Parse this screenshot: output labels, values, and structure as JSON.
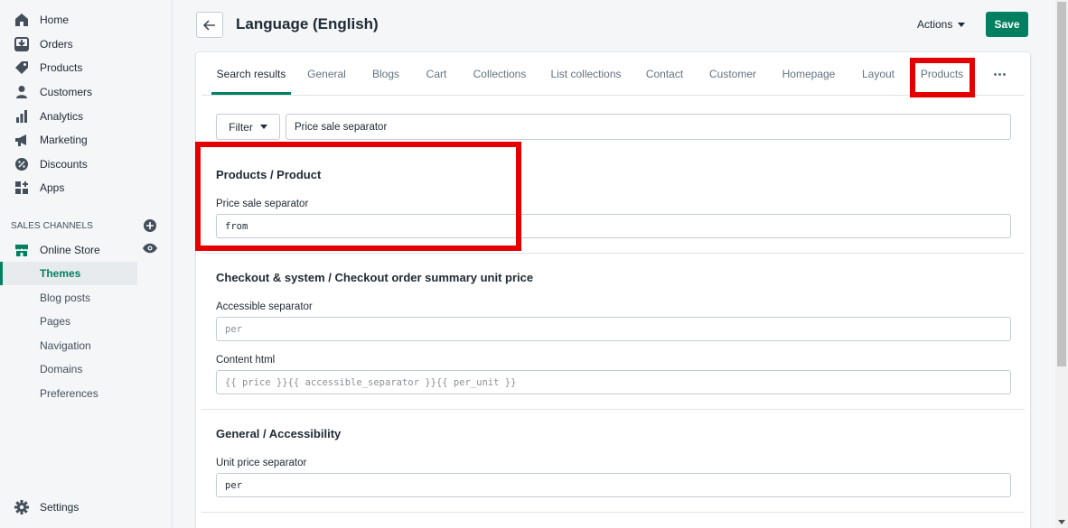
{
  "sidebar": {
    "nav": [
      {
        "label": "Home",
        "icon": "home-icon"
      },
      {
        "label": "Orders",
        "icon": "orders-icon"
      },
      {
        "label": "Products",
        "icon": "tag-icon"
      },
      {
        "label": "Customers",
        "icon": "person-icon"
      },
      {
        "label": "Analytics",
        "icon": "bar-chart-icon"
      },
      {
        "label": "Marketing",
        "icon": "megaphone-icon"
      },
      {
        "label": "Discounts",
        "icon": "discount-icon"
      },
      {
        "label": "Apps",
        "icon": "apps-icon"
      }
    ],
    "channels_heading": "SALES CHANNELS",
    "online_store": "Online Store",
    "sub_items": [
      "Themes",
      "Blog posts",
      "Pages",
      "Navigation",
      "Domains",
      "Preferences"
    ],
    "active_sub_item": "Themes",
    "settings": "Settings"
  },
  "header": {
    "title": "Language (English)",
    "actions_label": "Actions",
    "save_label": "Save"
  },
  "tabs": [
    "Search results",
    "General",
    "Blogs",
    "Cart",
    "Collections",
    "List collections",
    "Contact",
    "Customer",
    "Homepage",
    "Layout",
    "Products"
  ],
  "active_tab": "Search results",
  "filter": {
    "button_label": "Filter",
    "search_value": "Price sale separator"
  },
  "sections": [
    {
      "title": "Products / Product",
      "fields": [
        {
          "label": "Price sale separator",
          "value": "from",
          "is_placeholder": false
        }
      ]
    },
    {
      "title": "Checkout & system / Checkout order summary unit price",
      "fields": [
        {
          "label": "Accessible separator",
          "value": "per",
          "is_placeholder": true
        },
        {
          "label": "Content html",
          "value": "{{ price }}{{ accessible_separator }}{{ per_unit }}",
          "is_placeholder": true
        }
      ]
    },
    {
      "title": "General / Accessibility",
      "fields": [
        {
          "label": "Unit price separator",
          "value": "per",
          "is_placeholder": false
        }
      ]
    }
  ],
  "colors": {
    "accent": "#008060",
    "highlight": "#e50000",
    "sidebar_bg": "#f4f6f8"
  }
}
